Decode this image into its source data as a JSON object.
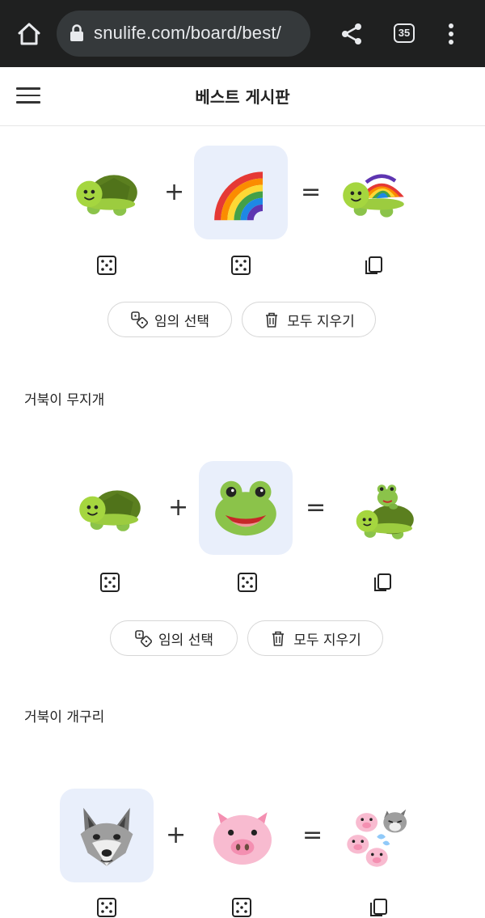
{
  "browser": {
    "url": "snulife.com/board/best/",
    "tab_count": "35",
    "icons": [
      "home-icon",
      "lock-icon",
      "share-icon",
      "tabs-icon",
      "more-vert-icon"
    ]
  },
  "header": {
    "title": "베스트 게시판",
    "menu_icon": "hamburger-icon"
  },
  "posts": [
    {
      "left_emoji": "turtle",
      "right_emoji": "rainbow",
      "result_emoji": "rainbow-shell turtle",
      "plus": "+",
      "equals": "=",
      "random_label": "임의 선택",
      "clear_label": "모두 지우기",
      "caption": "거북이 무지개"
    },
    {
      "left_emoji": "turtle",
      "right_emoji": "frog",
      "result_emoji": "frog riding turtle",
      "plus": "+",
      "equals": "=",
      "random_label": "임의 선택",
      "clear_label": "모두 지우기",
      "caption": "거북이 개구리"
    },
    {
      "left_emoji": "wolf",
      "right_emoji": "pig",
      "result_emoji": "three little pigs and wolf",
      "plus": "+",
      "equals": "="
    }
  ],
  "colors": {
    "browser_bar": "#1f2020",
    "url_pill": "#35393b",
    "selected_cell": "#e9effb",
    "turtle_body": "#a5d63f",
    "turtle_shell": "#6b8e23"
  }
}
